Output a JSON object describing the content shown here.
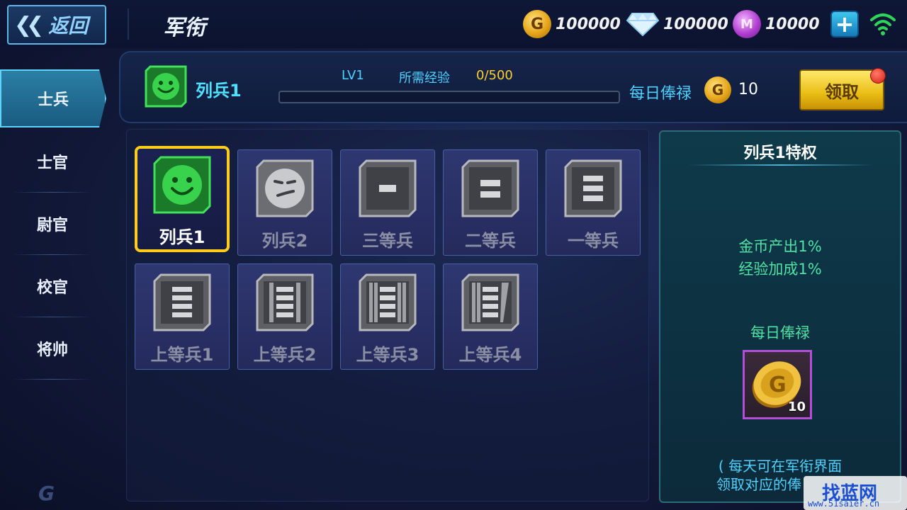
{
  "topbar": {
    "back_label": "返回",
    "title": "军衔",
    "gold": "100000",
    "diamond": "100000",
    "gem": "10000"
  },
  "sidebar": {
    "items": [
      {
        "label": "士兵"
      },
      {
        "label": "士官"
      },
      {
        "label": "尉官"
      },
      {
        "label": "校官"
      },
      {
        "label": "将帅"
      }
    ]
  },
  "header": {
    "rank_name": "列兵1",
    "level": "LV1",
    "exp_label": "所需经验",
    "exp_value": "0/500",
    "exp_progress": 0,
    "daily_label": "每日俸禄",
    "daily_value": "10",
    "claim_label": "领取"
  },
  "ranks": [
    {
      "label": "列兵1"
    },
    {
      "label": "列兵2"
    },
    {
      "label": "三等兵"
    },
    {
      "label": "二等兵"
    },
    {
      "label": "一等兵"
    },
    {
      "label": "上等兵1"
    },
    {
      "label": "上等兵2"
    },
    {
      "label": "上等兵3"
    },
    {
      "label": "上等兵4"
    }
  ],
  "privilege": {
    "title": "列兵1特权",
    "line1": "金币产出1%",
    "line2": "经验加成1%",
    "daily_label": "每日俸禄",
    "reward_qty": "10",
    "note1": "( 每天可在军衔界面",
    "note2": "领取对应的俸"
  },
  "watermark": {
    "text": "找蓝网",
    "url": "www.51saier.cn"
  },
  "icons": {
    "back": "double-chevron-left-icon",
    "gold": "gold-coin-icon",
    "diamond": "diamond-icon",
    "gem": "purple-gem-icon",
    "plus": "plus-icon",
    "wifi": "wifi-icon"
  },
  "colors": {
    "accent": "#4fd2ff",
    "gold": "#ffd02a",
    "green": "#4fe3a5",
    "selected_border": "#ffcc1a"
  }
}
